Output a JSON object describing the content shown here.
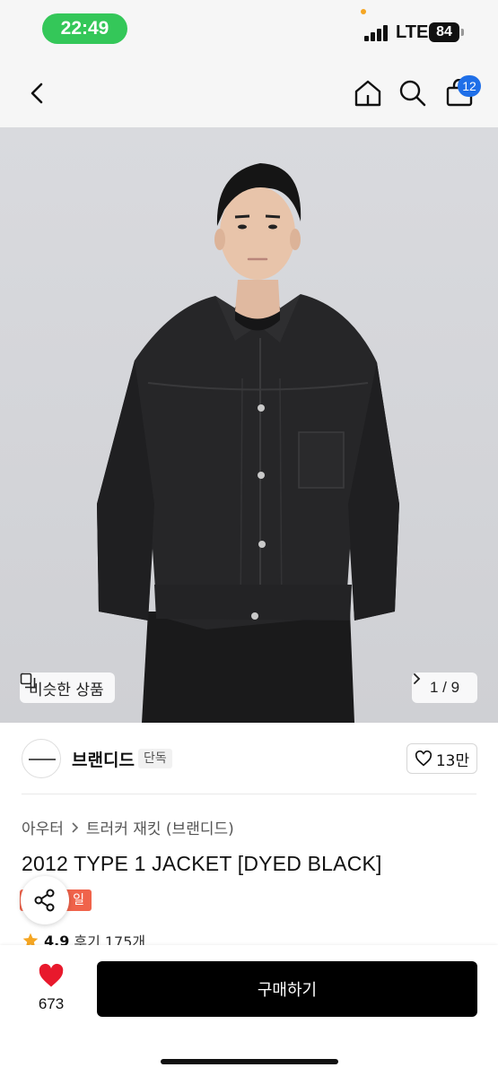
{
  "status": {
    "time": "22:49",
    "network": "LTE",
    "battery": "84"
  },
  "nav": {
    "cart_count": "12",
    "icons": [
      "back-icon",
      "home-icon",
      "search-icon",
      "bag-icon"
    ]
  },
  "hero": {
    "similar_label": "비슷한 상품",
    "counter": "1 / 9"
  },
  "brand": {
    "name": "브랜디드",
    "tag": "단독",
    "likes": "13만"
  },
  "product": {
    "breadcrumb": [
      "아우터",
      "트러커 재킷 (브랜디드)"
    ],
    "title": "2012 TYPE 1 JACKET [DYED BLACK]",
    "sale_badge": "일",
    "rating": "4.9",
    "reviews": "후기 175개"
  },
  "bottom": {
    "wish_count": "673",
    "buy_label": "구매하기"
  },
  "colors": {
    "status_pill": "#34c759",
    "cart_badge": "#1f6fe8",
    "sale_badge": "#f0634b",
    "heart": "#e8192c",
    "star": "#f5a623",
    "buy_button": "#000000"
  }
}
